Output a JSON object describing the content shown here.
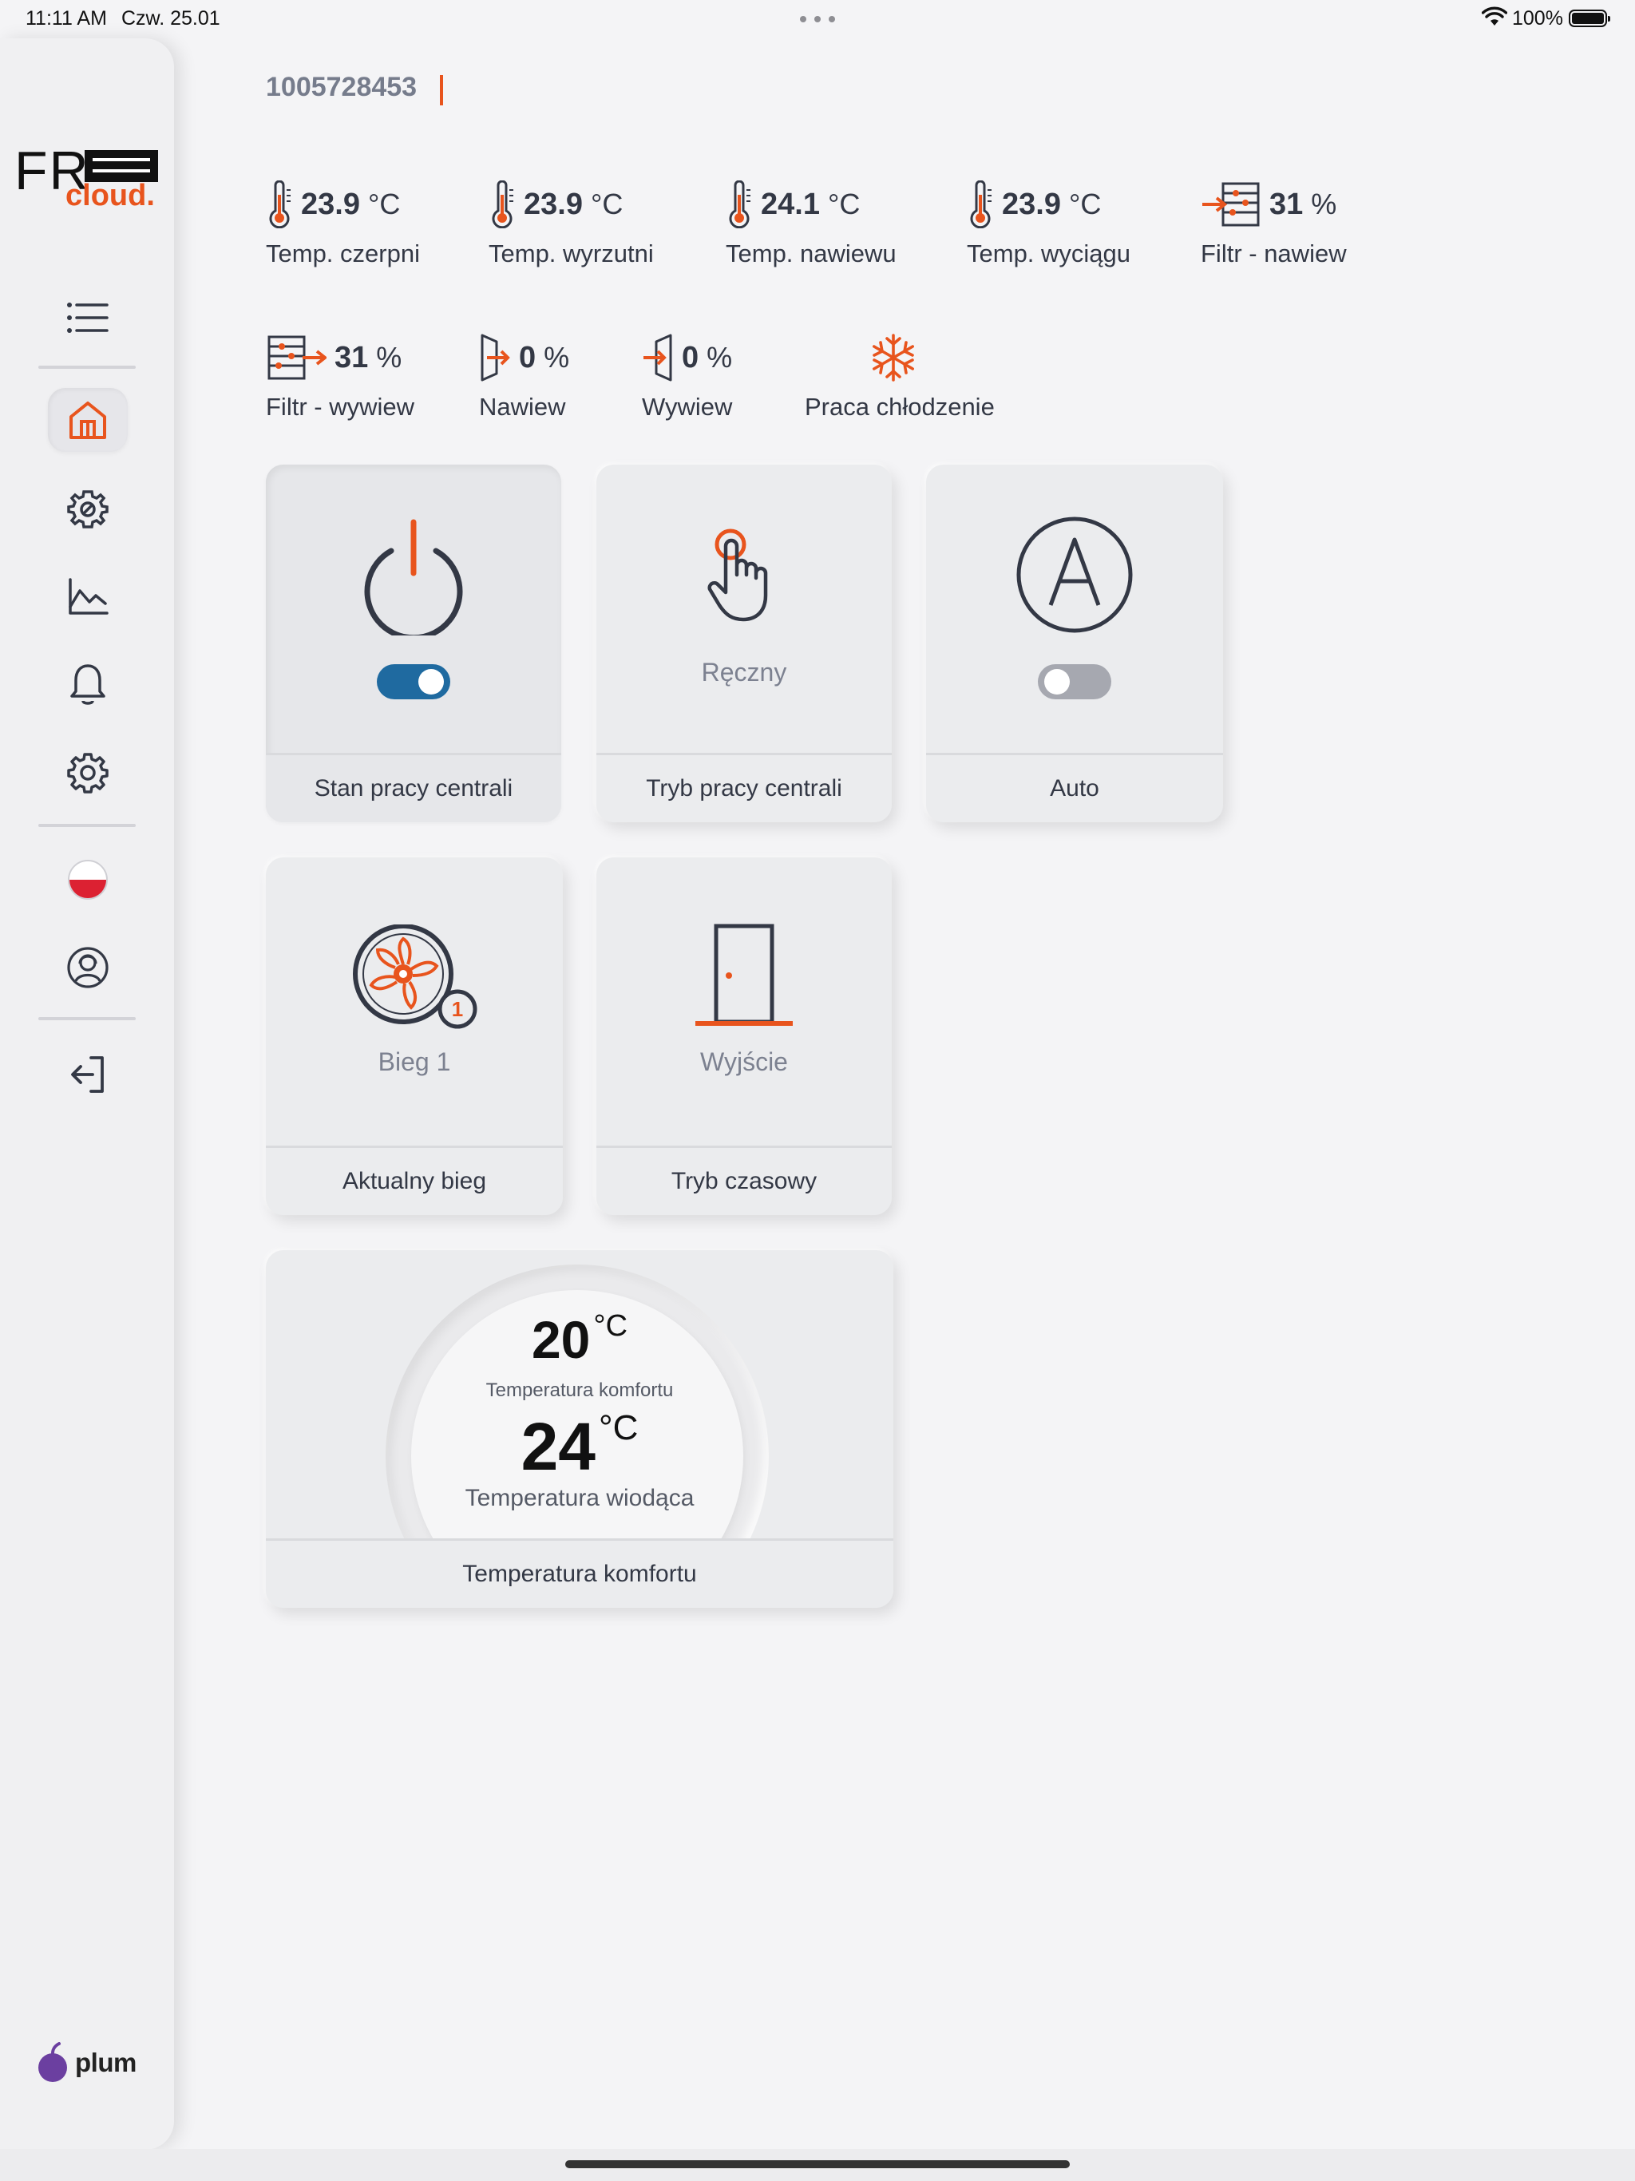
{
  "status_bar": {
    "time": "11:11 AM",
    "date": "Czw. 25.01",
    "battery": "100%"
  },
  "header": {
    "device_id": "1005728453"
  },
  "readings_row1": [
    {
      "value": "23.9",
      "unit": "°C",
      "label": "Temp. czerpni",
      "icon": "thermometer-icon"
    },
    {
      "value": "23.9",
      "unit": "°C",
      "label": "Temp. wyrzutni",
      "icon": "thermometer-icon"
    },
    {
      "value": "24.1",
      "unit": "°C",
      "label": "Temp. nawiewu",
      "icon": "thermometer-icon"
    },
    {
      "value": "23.9",
      "unit": "°C",
      "label": "Temp. wyciągu",
      "icon": "thermometer-icon"
    },
    {
      "value": "31",
      "unit": "%",
      "label": "Filtr - nawiew",
      "icon": "filter-supply-icon"
    }
  ],
  "readings_row2": [
    {
      "value": "31",
      "unit": "%",
      "label": "Filtr - wywiew",
      "icon": "filter-exhaust-icon"
    },
    {
      "value": "0",
      "unit": "%",
      "label": "Nawiew",
      "icon": "supply-damper-icon"
    },
    {
      "value": "0",
      "unit": "%",
      "label": "Wywiew",
      "icon": "exhaust-damper-icon"
    },
    {
      "value": "",
      "unit": "",
      "label": "Praca chłodzenie",
      "icon": "snowflake-icon"
    }
  ],
  "tiles": {
    "power": {
      "label": "Stan pracy centrali",
      "toggle_on": true
    },
    "mode": {
      "label": "Tryb pracy centrali",
      "value": "Ręczny"
    },
    "auto": {
      "label": "Auto",
      "toggle_on": false
    },
    "fan": {
      "label": "Aktualny bieg",
      "value": "Bieg 1",
      "badge": "1"
    },
    "timer": {
      "label": "Tryb czasowy",
      "value": "Wyjście"
    },
    "comfort": {
      "label": "Temperatura komfortu",
      "comfort_value": "20",
      "comfort_unit": "°C",
      "comfort_label": "Temperatura komfortu",
      "leading_value": "24",
      "leading_unit": "°C",
      "leading_label": "Temperatura wiodąca"
    }
  },
  "sidebar": {
    "logo_fr": "FR",
    "logo_cloud": "cloud.",
    "brand": "plum",
    "items": [
      "menu-icon",
      "home-icon",
      "service-gear-icon",
      "chart-icon",
      "bell-icon",
      "settings-icon",
      "language-flag",
      "user-icon",
      "logout-icon"
    ]
  },
  "colors": {
    "accent": "#e8541d",
    "dark": "#333845",
    "toggle_on": "#1f6aa0",
    "toggle_off": "#a6a8b0",
    "plum": "#6b3fa0"
  }
}
